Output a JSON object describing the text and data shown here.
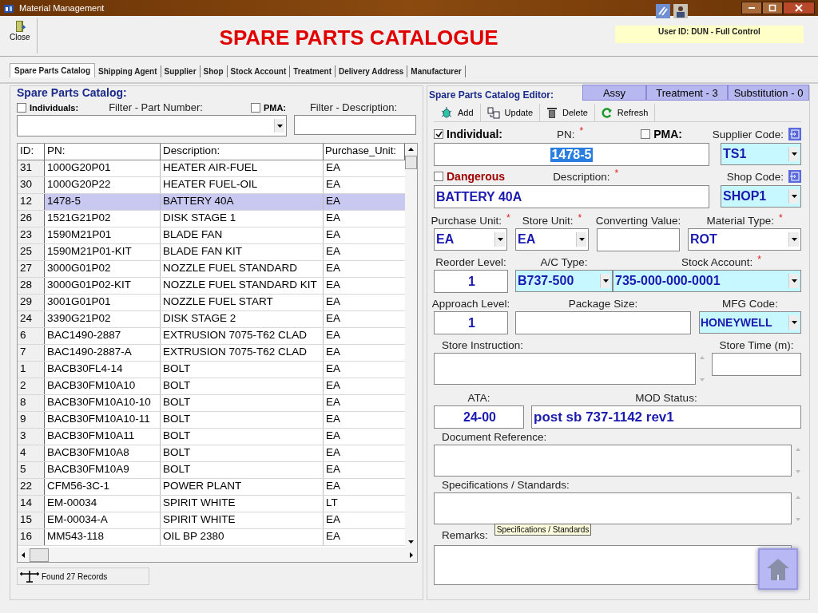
{
  "window": {
    "title": "Material Management"
  },
  "toolbar": {
    "close_label": "Close"
  },
  "page_title": "SPARE PARTS CATALOGUE",
  "user_info": "User ID: DUN - Full Control",
  "tabs": [
    {
      "label": "Spare Parts Catalog",
      "selected": true
    },
    {
      "label": "Shipping Agent",
      "selected": false
    },
    {
      "label": "Supplier",
      "selected": false
    },
    {
      "label": "Shop",
      "selected": false
    },
    {
      "label": "Stock Account",
      "selected": false
    },
    {
      "label": "Treatment",
      "selected": false
    },
    {
      "label": "Delivery Address",
      "selected": false
    },
    {
      "label": "Manufacturer",
      "selected": false
    }
  ],
  "catalog": {
    "title": "Spare Parts Catalog:",
    "individuals": {
      "label": "Individuals:",
      "checked": false
    },
    "filter_pn_label": "Filter - Part Number:",
    "pma": {
      "label": "PMA:",
      "checked": false
    },
    "filter_desc_label": "Filter - Description:",
    "columns": [
      "ID:",
      "PN:",
      "Description:",
      "Purchase_Unit:"
    ],
    "rows": [
      {
        "id": "31",
        "pn": "1000G20P01",
        "description": "HEATER AIR-FUEL",
        "unit": "EA",
        "selected": false
      },
      {
        "id": "30",
        "pn": "1000G20P22",
        "description": "HEATER FUEL-OIL",
        "unit": "EA",
        "selected": false
      },
      {
        "id": "12",
        "pn": "1478-5",
        "description": "BATTERY 40A",
        "unit": "EA",
        "selected": true
      },
      {
        "id": "26",
        "pn": "1521G21P02",
        "description": "DISK STAGE 1",
        "unit": "EA",
        "selected": false
      },
      {
        "id": "23",
        "pn": "1590M21P01",
        "description": "BLADE FAN",
        "unit": "EA",
        "selected": false
      },
      {
        "id": "25",
        "pn": "1590M21P01-KIT",
        "description": "BLADE FAN KIT",
        "unit": "EA",
        "selected": false
      },
      {
        "id": "27",
        "pn": "3000G01P02",
        "description": "NOZZLE FUEL STANDARD",
        "unit": "EA",
        "selected": false
      },
      {
        "id": "28",
        "pn": "3000G01P02-KIT",
        "description": "NOZZLE FUEL STANDARD KIT",
        "unit": "EA",
        "selected": false
      },
      {
        "id": "29",
        "pn": "3001G01P01",
        "description": "NOZZLE FUEL START",
        "unit": "EA",
        "selected": false
      },
      {
        "id": "24",
        "pn": "3390G21P02",
        "description": "DISK STAGE 2",
        "unit": "EA",
        "selected": false
      },
      {
        "id": "6",
        "pn": "BAC1490-2887",
        "description": "EXTRUSION 7075-T62 CLAD",
        "unit": "EA",
        "selected": false
      },
      {
        "id": "7",
        "pn": "BAC1490-2887-A",
        "description": "EXTRUSION 7075-T62 CLAD",
        "unit": "EA",
        "selected": false
      },
      {
        "id": "1",
        "pn": "BACB30FL4-14",
        "description": "BOLT",
        "unit": "EA",
        "selected": false
      },
      {
        "id": "2",
        "pn": "BACB30FM10A10",
        "description": "BOLT",
        "unit": "EA",
        "selected": false
      },
      {
        "id": "8",
        "pn": "BACB30FM10A10-10",
        "description": "BOLT",
        "unit": "EA",
        "selected": false
      },
      {
        "id": "9",
        "pn": "BACB30FM10A10-11",
        "description": "BOLT",
        "unit": "EA",
        "selected": false
      },
      {
        "id": "3",
        "pn": "BACB30FM10A11",
        "description": "BOLT",
        "unit": "EA",
        "selected": false
      },
      {
        "id": "4",
        "pn": "BACB30FM10A8",
        "description": "BOLT",
        "unit": "EA",
        "selected": false
      },
      {
        "id": "5",
        "pn": "BACB30FM10A9",
        "description": "BOLT",
        "unit": "EA",
        "selected": false
      },
      {
        "id": "22",
        "pn": "CFM56-3C-1",
        "description": "POWER PLANT",
        "unit": "EA",
        "selected": false
      },
      {
        "id": "14",
        "pn": "EM-00034",
        "description": "SPIRIT WHITE",
        "unit": "LT",
        "selected": false
      },
      {
        "id": "15",
        "pn": "EM-00034-A",
        "description": "SPIRIT WHITE",
        "unit": "EA",
        "selected": false
      },
      {
        "id": "16",
        "pn": "MM543-118",
        "description": "OIL BP 2380",
        "unit": "EA",
        "selected": false
      }
    ],
    "status": "Found 27 Records"
  },
  "editor": {
    "title": "Spare Parts Catalog Editor:",
    "side_buttons": [
      "Assy",
      "Treatment - 3",
      "Substitution - 0"
    ],
    "actions": [
      {
        "label": "Add",
        "kind": "add"
      },
      {
        "label": "Update",
        "kind": "update"
      },
      {
        "label": "Delete",
        "kind": "delete"
      },
      {
        "label": "Refresh",
        "kind": "refresh"
      }
    ],
    "individual": {
      "label": "Individual:",
      "checked": true
    },
    "pma": {
      "label": "PMA:",
      "checked": false
    },
    "dangerous": {
      "label": "Dangerous",
      "checked": false
    },
    "pn": {
      "label": "PN:",
      "required_mark": "*",
      "value": "1478-5"
    },
    "supplier_code": {
      "label": "Supplier Code:",
      "value": "TS1",
      "lookup": true
    },
    "description": {
      "label": "Description:",
      "required_mark": "*",
      "value": "BATTERY 40A"
    },
    "shop_code": {
      "label": "Shop Code:",
      "value": "SHOP1",
      "lookup": true
    },
    "purchase_unit": {
      "label": "Purchase Unit:",
      "required_mark": "*",
      "value": "EA",
      "lookup": false
    },
    "store_unit": {
      "label": "Store Unit:",
      "required_mark": "*",
      "value": "EA",
      "lookup": false
    },
    "converting_value": {
      "label": "Converting Value:"
    },
    "material_type": {
      "label": "Material Type:",
      "required_mark": "*",
      "value": "ROT",
      "lookup": false
    },
    "reorder_level": {
      "label": "Reorder Level:",
      "value": "1"
    },
    "ac_type": {
      "label": "A/C Type:",
      "value": "B737-500",
      "lookup": true
    },
    "stock_account": {
      "label": "Stock Account:",
      "required_mark": "*",
      "value": "735-000-000-0001",
      "lookup": true
    },
    "approach_level": {
      "label": "Approach Level:",
      "value": "1"
    },
    "package_size": {
      "label": "Package Size:"
    },
    "mfg_code": {
      "label": "MFG Code:",
      "value": "HONEYWELL",
      "lookup": true
    },
    "store_instruction": {
      "label": "Store Instruction:"
    },
    "store_time": {
      "label": "Store Time (m):"
    },
    "ata": {
      "label": "ATA:",
      "value": "24-00"
    },
    "mod_status": {
      "label": "MOD Status:",
      "value": "post sb 737-1142 rev1"
    },
    "document_reference": {
      "label": "Document Reference:"
    },
    "specifications": {
      "label": "Specifications / Standards:"
    },
    "remarks": {
      "label": "Remarks:"
    },
    "tooltip": "Specifications / Standards"
  }
}
